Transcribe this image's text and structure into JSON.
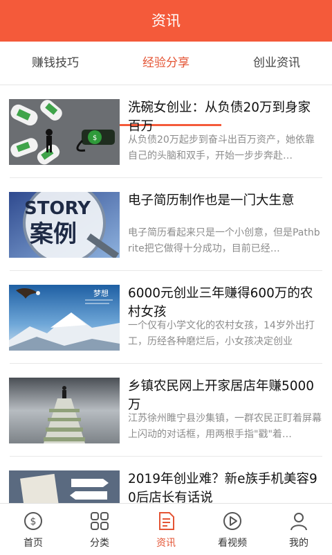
{
  "header": {
    "title": "资讯"
  },
  "tabs": [
    {
      "label": "赚钱技巧"
    },
    {
      "label": "经验分享"
    },
    {
      "label": "创业资讯"
    }
  ],
  "articles": [
    {
      "title": "洗碗女创业：从负债20万到身家百万",
      "desc": "从负债20万起步到奋斗出百万资产，她依靠自己的头脑和双手，开始一步步奔赴…"
    },
    {
      "title": "电子简历制作也是一门大生意",
      "desc": "电子简历看起来只是一个小创意，但是Pathbrite把它做得十分成功，目前已经…",
      "image_text": {
        "word1": "STORY",
        "word2": "案例"
      }
    },
    {
      "title": "6000元创业三年赚得600万的农村女孩",
      "desc": "一个仅有小学文化的农村女孩，14岁外出打工，历经各种磨烂后，小女孩决定创业",
      "image_text": {
        "word1": "梦想"
      }
    },
    {
      "title": "乡镇农民网上开家居店年赚5000万",
      "desc": "江苏徐州睢宁县沙集镇，一群农民正盯着屏幕上闪动的对话框，用两根手指\"戳\"着…"
    },
    {
      "title": "2019年创业难？新e族手机美容90后店长有话说",
      "desc": ""
    }
  ],
  "bottom_nav": [
    {
      "label": "首页",
      "icon": "dollar-circle-icon"
    },
    {
      "label": "分类",
      "icon": "grid-icon"
    },
    {
      "label": "资讯",
      "icon": "document-icon"
    },
    {
      "label": "看视频",
      "icon": "play-circle-icon"
    },
    {
      "label": "我的",
      "icon": "user-icon"
    }
  ],
  "colors": {
    "accent": "#f45a3a",
    "active_text": "#e45434",
    "nav_icon": "#555555"
  }
}
